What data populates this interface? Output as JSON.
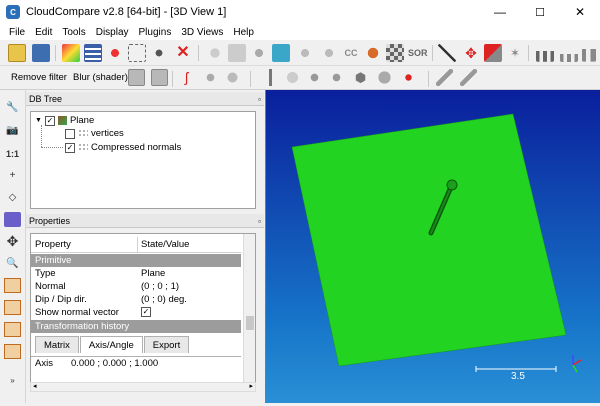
{
  "window": {
    "title": "CloudCompare v2.8 [64-bit] - [3D View 1]",
    "icon_letter": "C",
    "minimize": "—",
    "maximize": "☐",
    "close": "✕"
  },
  "menu": [
    "File",
    "Edit",
    "Tools",
    "Display",
    "Plugins",
    "3D Views",
    "Help"
  ],
  "toolbar2": {
    "remove_filter": "Remove filter",
    "blur_shader": "Blur (shader)"
  },
  "toolbar1_labels": {
    "sor": "SOR",
    "cc": "CC"
  },
  "left_toolbar": {
    "one_to_one": "1:1"
  },
  "db_tree": {
    "title": "DB Tree",
    "float_icon": "▫",
    "root": {
      "label": "Plane",
      "checked": true,
      "expanded": true
    },
    "children": [
      {
        "label": "vertices",
        "checked": false
      },
      {
        "label": "Compressed normals",
        "checked": true
      }
    ]
  },
  "properties": {
    "title": "Properties",
    "float_icon": "▫",
    "headers": {
      "property": "Property",
      "value": "State/Value"
    },
    "sections": {
      "primitive": "Primitive",
      "transformation": "Transformation history"
    },
    "rows": [
      {
        "key": "Type",
        "value": "Plane"
      },
      {
        "key": "Normal",
        "value": "(0 ; 0 ; 1)"
      },
      {
        "key": "Dip / Dip dir.",
        "value": "(0 ; 0) deg."
      },
      {
        "key": "Show normal vector",
        "value": "✓"
      }
    ],
    "tabs": [
      "Matrix",
      "Axis/Angle",
      "Export"
    ],
    "partial_row": {
      "key": "Axis",
      "value": "0.000 ; 0.000 ; 1.000"
    }
  },
  "view3d": {
    "scale_value": "3.5",
    "plane_color": "#22d322",
    "background_top": "#0a1f9c",
    "background_bottom": "#2a8fd6"
  }
}
